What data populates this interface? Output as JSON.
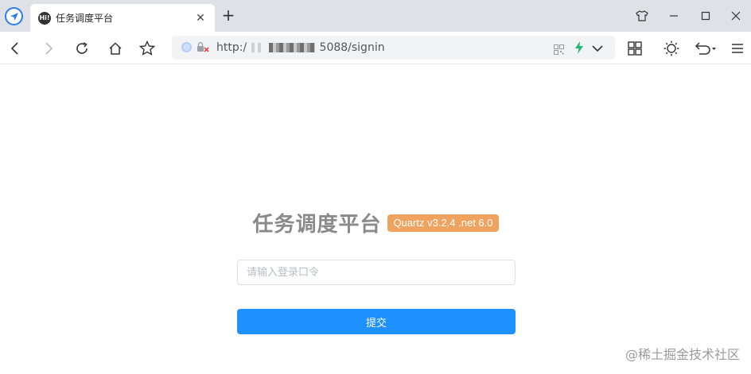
{
  "browser": {
    "tab": {
      "title": "任务调度平台",
      "favicon_text": "Hi!"
    },
    "address": {
      "url_prefix": "http:/",
      "url_suffix": "5088/signin"
    }
  },
  "page": {
    "title": "任务调度平台",
    "version_badge": "Quartz v3.2.4 .net 6.0",
    "password_placeholder": "请输入登录口令",
    "submit_label": "提交"
  },
  "watermark": "@稀土掘金技术社区",
  "colors": {
    "accent_button": "#1e90ff",
    "badge": "#f0a35e",
    "title_text": "#8a8a8a",
    "tabstrip": "#dee1e6"
  }
}
